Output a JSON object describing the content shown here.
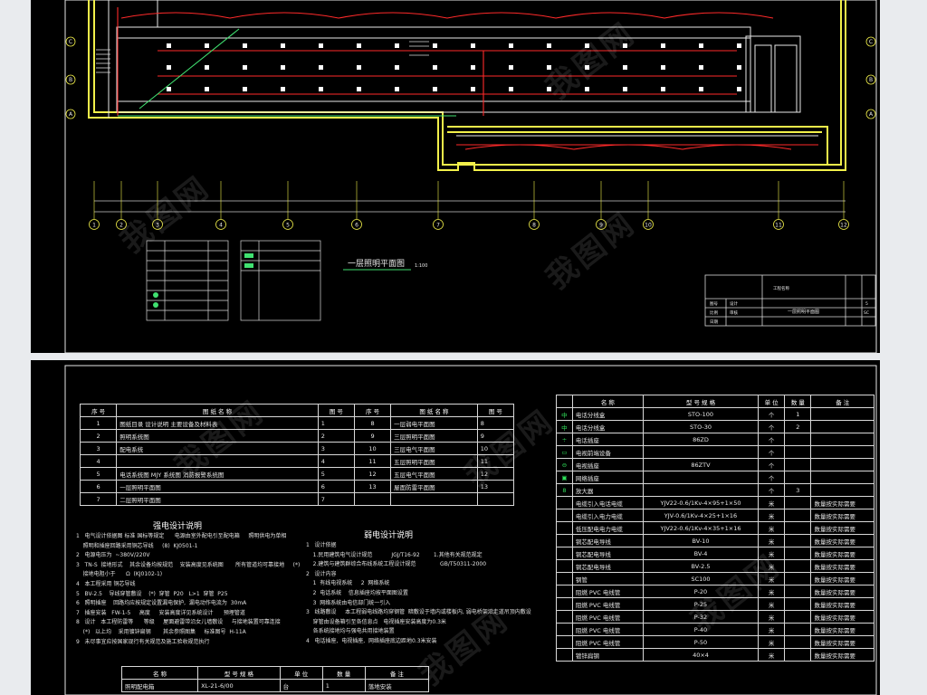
{
  "watermark": "我图网",
  "top_sheet": {
    "plan_title": "一层照明平面图",
    "scale": "1:100",
    "axis_numbers": [
      "1",
      "2",
      "3",
      "4",
      "5",
      "6",
      "7",
      "8",
      "9",
      "10",
      "11",
      "12"
    ],
    "row_axes": [
      "A",
      "B",
      "C"
    ],
    "title_block": {
      "cells": [
        "图号",
        "比例",
        "日期",
        "设计",
        "审核",
        "工程名称",
        "一层照明平面图",
        "5",
        "SC"
      ]
    }
  },
  "drawing_index": {
    "headers": [
      "序 号",
      "图 纸 名 称",
      "图 号",
      "序 号",
      "图 纸 名 称",
      "图 号"
    ],
    "rows": [
      [
        "1",
        "图纸目录  设计说明  主要设备及材料表",
        "1",
        "8",
        "一层弱电平面图",
        "8"
      ],
      [
        "2",
        "照明系统图",
        "2",
        "9",
        "三层照明平面图",
        "9"
      ],
      [
        "3",
        "配电系统",
        "3",
        "10",
        "三层电气平面图",
        "10"
      ],
      [
        "4",
        "",
        "4",
        "11",
        "五层照明平面图",
        "11"
      ],
      [
        "5",
        "电话系统图  MJY  系统图  消防报警系统图",
        "5",
        "12",
        "五层电气平面图",
        "12"
      ],
      [
        "6",
        "一层照明平面图",
        "6",
        "13",
        "屋面防雷平面图",
        "13"
      ],
      [
        "7",
        "二层照明平面图",
        "7",
        "",
        "",
        ""
      ]
    ]
  },
  "strong_notes": {
    "title": "强电设计说明",
    "lines": [
      "1   电气设计依据图 标准 国标等规定      电源由室外配电引至配电箱     照明供电为单相",
      "    照明和插座回路采用铜芯导线     (8)  KJ0501-1",
      "2   电源电压为  ~380V/220V",
      "3   TN-S  接地形式    其余设备均按规范    安装高度见系统图       所有管道均可靠接地     (*)",
      "    接地电阻小于      Ω  (KJ0102-1)",
      "4   本工程采用 铜芯导线",
      "5   BV-2.5    导线穿管敷设    (*)  穿管  P20   L>1  穿管  P25",
      "6   照明插座    回路均应按规定设置漏电保护,  漏电动作电流为  30mA",
      "7   插座安装   FW-1-5     高度     安装高度详见系统设计      预埋管道     ",
      "8   设计   本工程防雷等      等级     屋面避雷带沿女儿墙敷设     与接地装置可靠连接",
      "    (*)   以上均    采用镀锌扁钢       其余参照图集     标准图号  H-11A",
      "9   未尽事宜应按国家现行有关规范及施工验收规范执行"
    ]
  },
  "weak_notes": {
    "title": "弱电设计说明",
    "lines": [
      "1   设计依据",
      "    1.民用建筑电气设计规范           JGJ/T16-92        1.其他有关规范规定",
      "    2.建筑与建筑群综合布线系统工程设计规范              GB/T50311-2000",
      "2   设计内容",
      "    1  有线电视系统     2  网络系统",
      "    2  电话系统    信息插座均按平面图设置",
      "    3  网络系统由电信部门统一引入",
      "3   线路敷设     本工程弱电线路均穿钢管  暗敷设于墙内或楼板内, 弱电桥架沿走道吊顶内敷设",
      "    穿管由设备箱引至各信息点   电视插座安装高度为0.3米",
      "    各系统接地均与强电共用接地装置",
      "4   电话插座,  电视插座,  网络插座底边距地0.3米安装"
    ]
  },
  "legend": {
    "headers": [
      "",
      "名  称",
      "型  号  规  格",
      "单 位",
      "数 量",
      "备  注"
    ],
    "rows": [
      {
        "icon": "中",
        "name": "电话分线盒",
        "model": "STO-100",
        "unit": "个",
        "qty": "1",
        "note": ""
      },
      {
        "icon": "中",
        "name": "电话分线盒",
        "model": "STO-30",
        "unit": "个",
        "qty": "2",
        "note": ""
      },
      {
        "icon": "÷",
        "name": "电话插座",
        "model": "86ZD",
        "unit": "个",
        "qty": "",
        "note": ""
      },
      {
        "icon": "▭",
        "name": "电视前端设备",
        "model": "",
        "unit": "个",
        "qty": "",
        "note": ""
      },
      {
        "icon": "⊖",
        "name": "电视插座",
        "model": "86ZTV",
        "unit": "个",
        "qty": "",
        "note": ""
      },
      {
        "icon": "▣",
        "name": "网络插座",
        "model": "",
        "unit": "个",
        "qty": "",
        "note": ""
      },
      {
        "icon": "8",
        "name": "放大器",
        "model": "",
        "unit": "个",
        "qty": "3",
        "note": ""
      },
      {
        "icon": "",
        "name": "电缆引入电话电缆",
        "model": "YJV22-0.6/1Kv-4×95+1×50",
        "unit": "米",
        "qty": "",
        "note": "数量按实际需要"
      },
      {
        "icon": "",
        "name": "电缆引入电力电缆",
        "model": "YJV-0.6/1Kv-4×25+1×16",
        "unit": "米",
        "qty": "",
        "note": "数量按实际需要"
      },
      {
        "icon": "",
        "name": "低压配电电力电缆",
        "model": "YJV22-0.6/1Kv-4×35+1×16",
        "unit": "米",
        "qty": "",
        "note": "数量按实际需要"
      },
      {
        "icon": "",
        "name": "铜芯配电导线",
        "model": "BV-10",
        "unit": "米",
        "qty": "",
        "note": "数量按实际需要"
      },
      {
        "icon": "",
        "name": "铜芯配电导线",
        "model": "BV-4",
        "unit": "米",
        "qty": "",
        "note": "数量按实际需要"
      },
      {
        "icon": "",
        "name": "铜芯配电导线",
        "model": "BV-2.5",
        "unit": "米",
        "qty": "",
        "note": "数量按实际需要"
      },
      {
        "icon": "",
        "name": "钢管",
        "model": "SC100",
        "unit": "米",
        "qty": "",
        "note": "数量按实际需要"
      },
      {
        "icon": "",
        "name": "阻燃  PVC  电线管",
        "model": "P-20",
        "unit": "米",
        "qty": "",
        "note": "数量按实际需要"
      },
      {
        "icon": "",
        "name": "阻燃  PVC  电线管",
        "model": "P-25",
        "unit": "米",
        "qty": "",
        "note": "数量按实际需要"
      },
      {
        "icon": "",
        "name": "阻燃  PVC  电线管",
        "model": "P-32",
        "unit": "米",
        "qty": "",
        "note": "数量按实际需要"
      },
      {
        "icon": "",
        "name": "阻燃  PVC  电线管",
        "model": "P-40",
        "unit": "米",
        "qty": "",
        "note": "数量按实际需要"
      },
      {
        "icon": "",
        "name": "阻燃  PVC  电线管",
        "model": "P-50",
        "unit": "米",
        "qty": "",
        "note": "数量按实际需要"
      },
      {
        "icon": "",
        "name": "镀锌扁钢",
        "model": "40×4",
        "unit": "米",
        "qty": "",
        "note": "数量按实际需要"
      }
    ]
  },
  "equipment": {
    "headers": [
      "名  称",
      "型  号  规  格",
      "单 位",
      "数 量",
      "备  注"
    ],
    "rows": [
      {
        "name": "照明配电箱",
        "model": "XL-21-6/00",
        "unit": "台",
        "qty": "1",
        "note": "落地安装"
      }
    ]
  }
}
